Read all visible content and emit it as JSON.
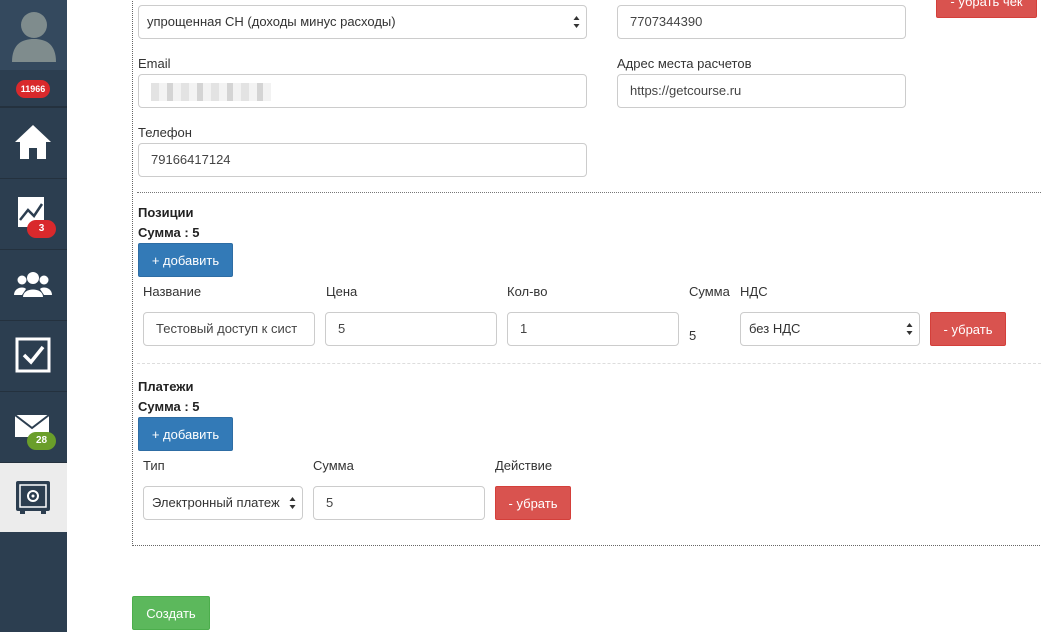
{
  "sidebar": {
    "total_count": "11966",
    "items": [
      {
        "name": "home",
        "badge": ""
      },
      {
        "name": "stats",
        "badge": "3"
      },
      {
        "name": "users",
        "badge": ""
      },
      {
        "name": "tasks",
        "badge": ""
      },
      {
        "name": "messages",
        "badge": "28"
      },
      {
        "name": "safe",
        "badge": ""
      }
    ]
  },
  "receipt": {
    "tax_system": "упрощенная СН (доходы минус расходы)",
    "inn": "7707344390",
    "remove_receipt_label": "- убрать чек",
    "email_label": "Email",
    "email_value": "",
    "address_label": "Адрес места расчетов",
    "address_value": "https://getcourse.ru",
    "phone_label": "Телефон",
    "phone_value": "79166417124"
  },
  "positions": {
    "title": "Позиции",
    "sum_text": "Сумма : 5",
    "add_label": "+ добавить",
    "headers": {
      "name": "Название",
      "price": "Цена",
      "qty": "Кол-во",
      "sum": "Сумма",
      "vat": "НДС"
    },
    "rows": [
      {
        "name": "Тестовый доступ к сист",
        "price": "5",
        "qty": "1",
        "sum": "5",
        "vat": "без НДС",
        "remove_label": "- убрать"
      }
    ]
  },
  "payments": {
    "title": "Платежи",
    "sum_text": "Сумма : 5",
    "add_label": "+ добавить",
    "headers": {
      "type": "Тип",
      "sum": "Сумма",
      "action": "Действие"
    },
    "rows": [
      {
        "type": "Электронный платеж",
        "sum": "5",
        "remove_label": "- убрать"
      }
    ]
  },
  "create_label": "Создать",
  "colors": {
    "sidebar_bg": "#2c3e50",
    "primary": "#337ab7",
    "danger": "#d9534f",
    "success": "#5cb85c"
  }
}
